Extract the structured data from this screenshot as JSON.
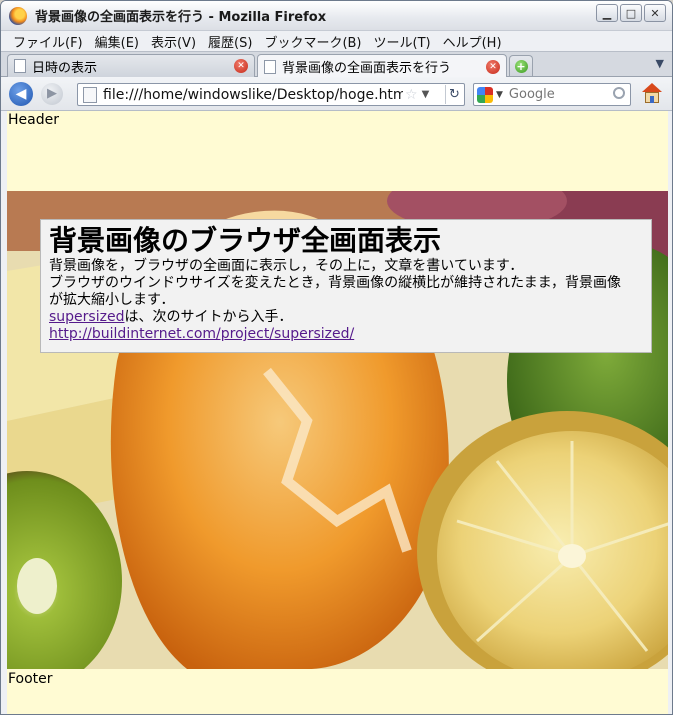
{
  "window": {
    "title": "背景画像の全画面表示を行う - Mozilla Firefox"
  },
  "menu": {
    "items": [
      "ファイル(F)",
      "編集(E)",
      "表示(V)",
      "履歴(S)",
      "ブックマーク(B)",
      "ツール(T)",
      "ヘルプ(H)"
    ]
  },
  "tabs": [
    {
      "label": "日時の表示",
      "active": false
    },
    {
      "label": "背景画像の全画面表示を行う",
      "active": true
    }
  ],
  "navbar": {
    "url": "file:///home/windowslike/Desktop/hoge.html",
    "search_placeholder": "Google"
  },
  "page": {
    "header": "Header",
    "footer": "Footer",
    "heading": "背景画像のブラウザ全画面表示",
    "line1": "背景画像を，ブラウザの全画面に表示し，その上に，文章を書いています．",
    "line2": "ブラウザのウインドウサイズを変えたとき，背景画像の縦横比が維持されたまま，背景画像",
    "line3": "が拡大縮小します．",
    "link1_text": "supersized",
    "link1_suffix": "は、次のサイトから入手．",
    "link2_text": "http://buildinternet.com/project/supersized/"
  },
  "colors": {
    "page_background": "#fffbd3",
    "info_box_background": "#f2f2f2",
    "visited_link": "#551a8b"
  }
}
